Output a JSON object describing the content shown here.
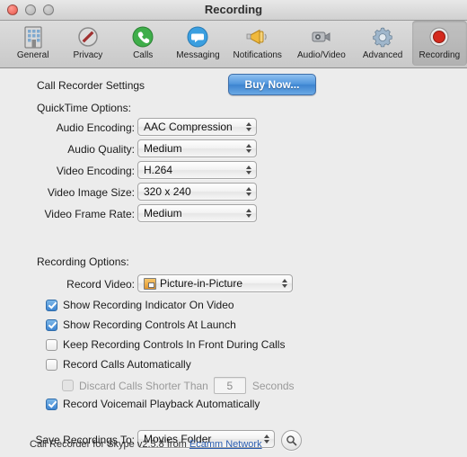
{
  "window": {
    "title": "Recording",
    "traffic_lights": [
      "close",
      "minimize",
      "zoom"
    ]
  },
  "toolbar": {
    "items": [
      {
        "label": "General",
        "icon": "building-icon",
        "selected": false
      },
      {
        "label": "Privacy",
        "icon": "no-entry-icon",
        "selected": false
      },
      {
        "label": "Calls",
        "icon": "phone-icon",
        "selected": false
      },
      {
        "label": "Messaging",
        "icon": "speech-bubble-icon",
        "selected": false
      },
      {
        "label": "Notifications",
        "icon": "megaphone-icon",
        "selected": false
      },
      {
        "label": "Audio/Video",
        "icon": "camera-icon",
        "selected": false
      },
      {
        "label": "Advanced",
        "icon": "gear-icon",
        "selected": false
      },
      {
        "label": "Recording",
        "icon": "record-icon",
        "selected": true
      }
    ]
  },
  "main": {
    "call_recorder_settings_label": "Call Recorder Settings",
    "buy_now_label": "Buy Now...",
    "quicktime_options_label": "QuickTime Options:",
    "quicktime_fields": [
      {
        "label": "Audio Encoding:",
        "value": "AAC Compression"
      },
      {
        "label": "Audio Quality:",
        "value": "Medium"
      },
      {
        "label": "Video Encoding:",
        "value": "H.264"
      },
      {
        "label": "Video Image Size:",
        "value": "320 x 240"
      },
      {
        "label": "Video Frame Rate:",
        "value": "Medium"
      }
    ],
    "recording_options_label": "Recording Options:",
    "record_video_label": "Record Video:",
    "record_video_value": "Picture-in-Picture",
    "checkboxes": [
      {
        "label": "Show Recording Indicator On Video",
        "checked": true,
        "enabled": true
      },
      {
        "label": "Show Recording Controls At Launch",
        "checked": true,
        "enabled": true
      },
      {
        "label": "Keep Recording Controls In Front During Calls",
        "checked": false,
        "enabled": true
      },
      {
        "label": "Record Calls Automatically",
        "checked": false,
        "enabled": true
      },
      {
        "label": "Discard Calls Shorter Than",
        "checked": false,
        "enabled": false,
        "indented": true,
        "field_value": "5",
        "suffix": "Seconds"
      },
      {
        "label": "Record Voicemail Playback Automatically",
        "checked": true,
        "enabled": true
      }
    ],
    "save_recordings_label": "Save Recordings To:",
    "save_recordings_value": "Movies Folder",
    "reveal_button_icon": "magnifier-icon",
    "footer_text": "Call Recorder for Skype v2.5.8 from ",
    "footer_link": "Ecamm Network"
  },
  "colors": {
    "accent_blue": "#3d84d0",
    "link_blue": "#2a5db0",
    "window_bg": "#ececec",
    "record_red": "#d42a1e"
  }
}
